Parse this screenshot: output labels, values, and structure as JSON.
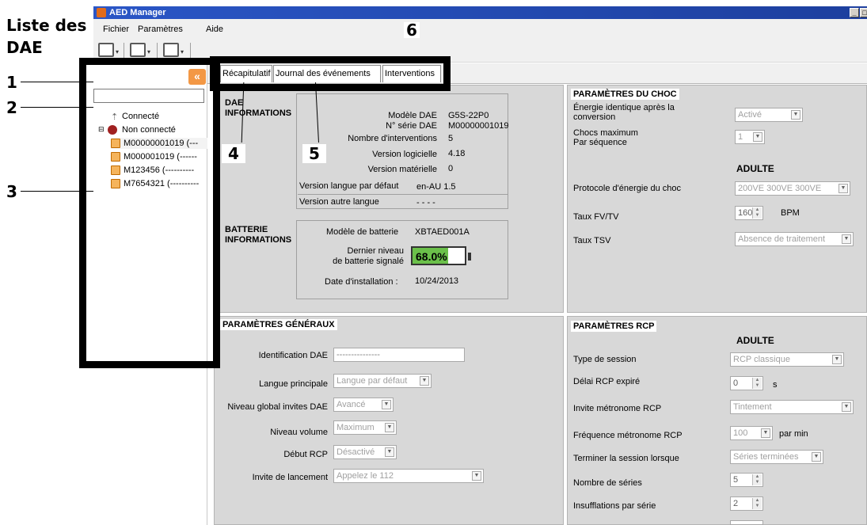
{
  "annotations": {
    "heading": "Liste des DAE",
    "n1": "1",
    "n2": "2",
    "n3": "3",
    "n4": "4",
    "n5": "5",
    "n6": "6"
  },
  "window": {
    "title": "AED Manager",
    "min_icon": "minimize-icon",
    "max_icon": "maximize-icon"
  },
  "menu": {
    "items": [
      "Fichier",
      "Paramètres",
      "Aide"
    ]
  },
  "toolbar": {
    "icons": [
      "open-folder-icon",
      "save-icon",
      "export-icon"
    ]
  },
  "sidebar": {
    "collapse_glyph": "«",
    "search_placeholder": "",
    "groups": [
      {
        "label": "Connecté",
        "icon": "usb-icon"
      },
      {
        "label": "Non connecté",
        "icon": "disconnected-icon"
      }
    ],
    "devices": [
      "M00000001019 (---",
      "M000001019 (------",
      "M123456 (----------",
      "M7654321 (----------"
    ]
  },
  "tabs": [
    "Récapitulatif",
    "Journal des événements",
    "Interventions"
  ],
  "dae_info": {
    "title": "DAE\nINFORMATIONS",
    "rows": [
      {
        "label": "Modèle DAE",
        "value": "G5S-22P0"
      },
      {
        "label": "N° série DAE",
        "value": "M00000001019"
      },
      {
        "label": "Nombre d'interventions",
        "value": "5"
      },
      {
        "label": "Version logicielle",
        "value": "4.18"
      },
      {
        "label": "Version matérielle",
        "value": "0"
      }
    ],
    "lang_default_label": "Version langue par défaut",
    "lang_default_value": "en-AU  1.5",
    "lang_other_label": "Version autre langue",
    "lang_other_value": "- - - -"
  },
  "battery_info": {
    "title": "BATTERIE\nINFORMATIONS",
    "model_label": "Modèle de batterie",
    "model_value": "XBTAED001A",
    "level_label": "Dernier niveau\nde batterie signalé",
    "level_value": "68.0%",
    "level_fraction": 0.68,
    "install_label": "Date d'installation :",
    "install_value": "10/24/2013"
  },
  "shock": {
    "title": "PARAMÈTRES DU CHOC",
    "identical_label": "Énergie identique après la\nconversion",
    "identical_value": "Activé",
    "max_label": "Chocs maximum\nPar séquence",
    "max_value": "1",
    "adult_header": "ADULTE",
    "protocol_label": "Protocole d'énergie du choc",
    "protocol_value": "200VE 300VE 300VE",
    "fv_label": "Taux FV/TV",
    "fv_value": "160",
    "fv_unit": "BPM",
    "tsv_label": "Taux TSV",
    "tsv_value": "Absence de traitement"
  },
  "general": {
    "title": "PARAMÈTRES GÉNÉRAUX",
    "id_label": "Identification DAE",
    "id_value": "---------------",
    "lang_label": "Langue principale",
    "lang_value": "Langue par défaut",
    "level_label": "Niveau global invites DAE",
    "level_value": "Avancé",
    "volume_label": "Niveau volume",
    "volume_value": "Maximum",
    "rcp_label": "Début RCP",
    "rcp_value": "Désactivé",
    "launch_label": "Invite de lancement",
    "launch_value": "Appelez le 112"
  },
  "rcp": {
    "title": "PARAMÈTRES RCP",
    "adult_header": "ADULTE",
    "session_label": "Type de session",
    "session_value": "RCP classique",
    "delay_label": "Délai RCP expiré",
    "delay_value": "0",
    "delay_unit": "s",
    "metro_label": "Invite métronome RCP",
    "metro_value": "Tintement",
    "freq_label": "Fréquence métronome RCP",
    "freq_value": "100",
    "freq_unit": "par min",
    "end_label": "Terminer la session lorsque",
    "end_value": "Séries terminées",
    "series_label": "Nombre de séries",
    "series_value": "5",
    "insuff_label": "Insufflations par série",
    "insuff_value": "2"
  }
}
